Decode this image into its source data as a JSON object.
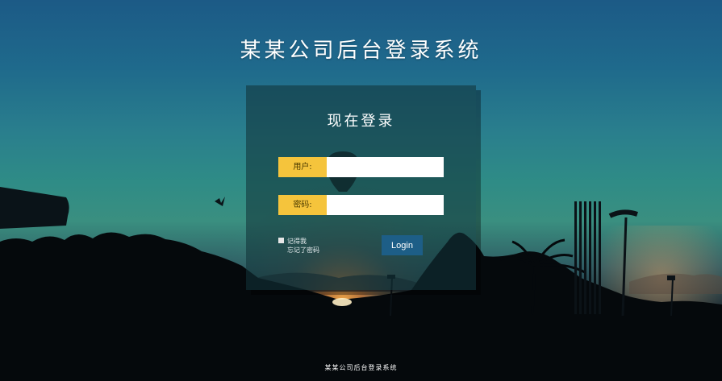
{
  "site": {
    "title": "某某公司后台登录系统",
    "footer": "某某公司后台登录系统"
  },
  "login": {
    "heading": "现在登录",
    "username_label": "用户:",
    "username_value": "",
    "password_label": "密码:",
    "password_value": "",
    "remember_label": "记得我",
    "forgot_label": "忘记了密码",
    "submit_label": "Login"
  },
  "colors": {
    "label_accent": "#f5c43c",
    "button": "#1d5e87",
    "panel": "rgba(18,52,56,0.58)"
  }
}
